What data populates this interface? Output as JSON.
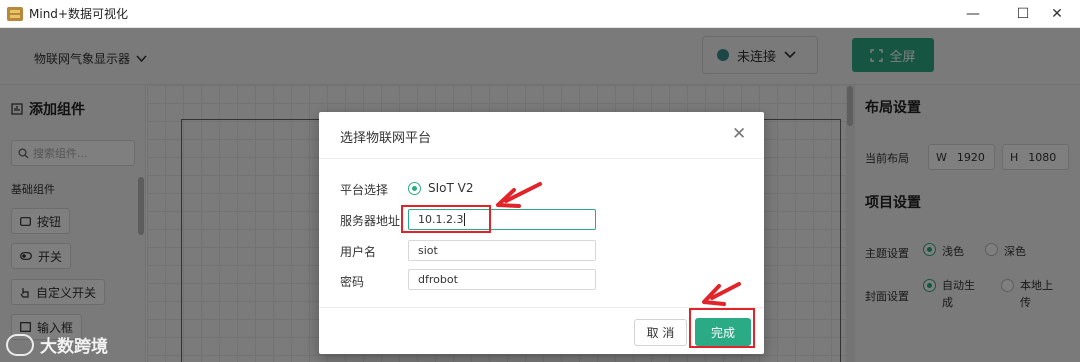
{
  "window": {
    "title": "Mind+数据可视化",
    "controls": {
      "minimize": "—",
      "maximize": "☐",
      "close": "✕"
    }
  },
  "topbar": {
    "project_name": "物联网气象显示器",
    "connection_status": "未连接",
    "fullscreen_label": "全屏"
  },
  "left_panel": {
    "title": "添加组件",
    "search_placeholder": "搜索组件...",
    "section_basic": "基础组件",
    "components": [
      {
        "label": "按钮"
      },
      {
        "label": "开关"
      },
      {
        "label": "自定义开关"
      },
      {
        "label": "输入框"
      }
    ]
  },
  "right_panel": {
    "layout_title": "布局设置",
    "current_layout_label": "当前布局",
    "width_label": "W",
    "width_value": "1920",
    "height_label": "H",
    "height_value": "1080",
    "project_title": "项目设置",
    "theme_label": "主题设置",
    "theme_options": [
      "浅色",
      "深色"
    ],
    "theme_selected": "浅色",
    "cover_label": "封面设置",
    "cover_options": [
      "自动生\n成",
      "本地上\n传"
    ],
    "cover_selected": "自动生成"
  },
  "dialog": {
    "title": "选择物联网平台",
    "close_icon": "✕",
    "platform_label": "平台选择",
    "platform_option": "SIoT V2",
    "server_label": "服务器地址",
    "server_value": "10.1.2.3",
    "username_label": "用户名",
    "username_value": "siot",
    "password_label": "密码",
    "password_value": "dfrobot",
    "cancel_label": "取 消",
    "done_label": "完成"
  },
  "watermark": {
    "text": "大数跨境"
  },
  "colors": {
    "accent": "#2bab85",
    "annotation_red": "#e0242a",
    "status_dot": "#3a8f8a",
    "overlay": "rgba(0,0,0,0.5)"
  }
}
